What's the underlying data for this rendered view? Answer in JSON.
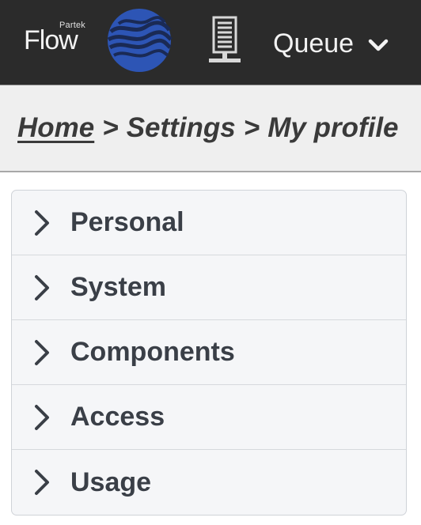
{
  "header": {
    "logo_small_text": "Partek",
    "logo_text": "Flow",
    "queue_label": "Queue"
  },
  "breadcrumb": {
    "home": "Home",
    "separator": ">",
    "settings": "Settings",
    "current": "My profile"
  },
  "accordion": {
    "items": [
      {
        "label": "Personal"
      },
      {
        "label": "System"
      },
      {
        "label": "Components"
      },
      {
        "label": "Access"
      },
      {
        "label": "Usage"
      }
    ]
  },
  "icons": {
    "logo": "partek-flow-globe-logo",
    "server": "server-icon",
    "queue_dropdown": "chevron-down-icon",
    "accordion_toggle": "chevron-right-icon"
  },
  "colors": {
    "topbar_bg": "#2b2b2b",
    "crumbbar_bg": "#efefef",
    "accordion_bg": "#f5f6f8",
    "logo_blue": "#2d55b5",
    "text_dark": "#3a3f47"
  }
}
